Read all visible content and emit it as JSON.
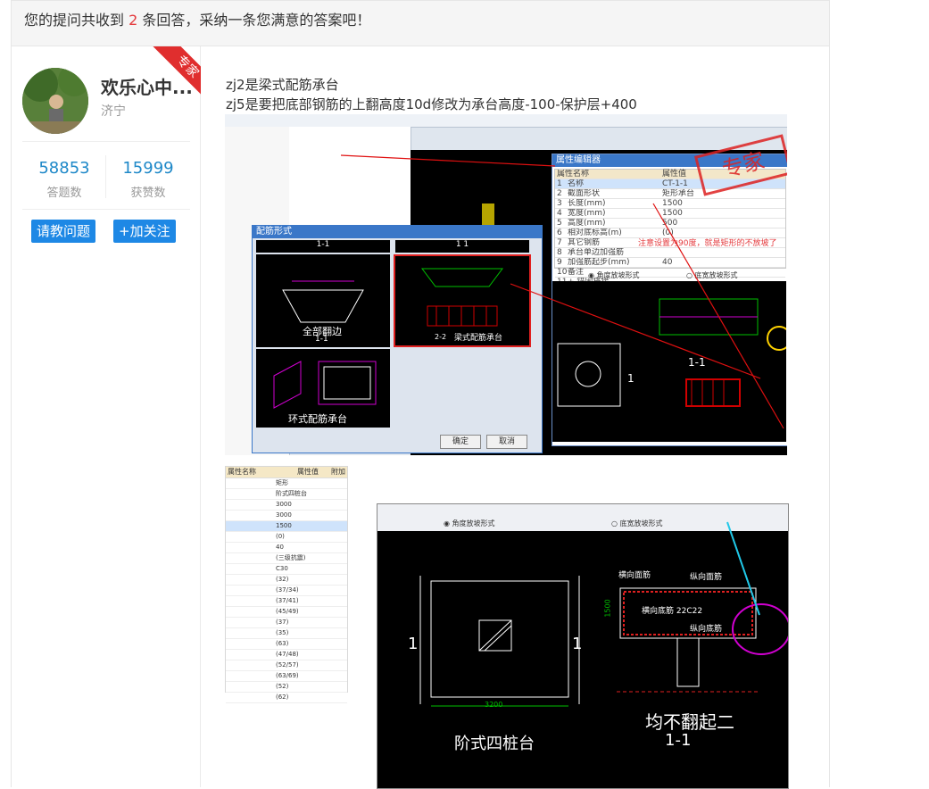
{
  "header": {
    "prefix": "您的提问共收到",
    "count": "2",
    "suffix": "条回答，采纳一条您满意的答案吧！"
  },
  "user": {
    "name": "欢乐心中...",
    "city": "济宁",
    "badge": "专家",
    "answers_value": "58853",
    "answers_label": "答题数",
    "likes_value": "15999",
    "likes_label": "获赞数"
  },
  "buttons": {
    "ask": "请教问题",
    "follow": "+加关注"
  },
  "answer": {
    "line1": "zj2是梁式配筋承台",
    "line2": "zj5是要把底部钢筋的上翻高度10d修改为承台高度-100-保护层+400"
  },
  "screenshot1": {
    "dialog_title": "配筋形式",
    "section_a": "1-1",
    "section_b": "1  1",
    "opt1": "全部翻边",
    "opt1_sec": "1-1",
    "opt2": "梁式配筋承台",
    "opt2_sec": "2-2",
    "opt3": "环式配筋承台",
    "ok": "确定",
    "cancel": "取消",
    "stamp": "专家",
    "note": "注意设置为90度，就是矩形的不放坡了",
    "prop_title": "属性编辑器",
    "prop_header_name": "属性名称",
    "prop_header_value": "属性值",
    "rows": [
      {
        "n": "1",
        "name": "名称",
        "value": "CT-1-1"
      },
      {
        "n": "2",
        "name": "截面形状",
        "value": "矩形承台"
      },
      {
        "n": "3",
        "name": "长度(mm)",
        "value": "1500"
      },
      {
        "n": "4",
        "name": "宽度(mm)",
        "value": "1500"
      },
      {
        "n": "5",
        "name": "高度(mm)",
        "value": "500"
      },
      {
        "n": "6",
        "name": "相对底标高(m)",
        "value": "(0)"
      },
      {
        "n": "7",
        "name": "其它钢筋",
        "value": ""
      },
      {
        "n": "8",
        "name": "承台单边加强筋",
        "value": ""
      },
      {
        "n": "9",
        "name": "加强筋起步(mm)",
        "value": "40"
      },
      {
        "n": "10",
        "name": "备注",
        "value": ""
      },
      {
        "n": "11",
        "name": "+ 锚固搭接",
        "value": ""
      }
    ],
    "radio1": "角度放坡形式",
    "radio2": "底宽放坡形式",
    "label_section": "1-1",
    "label_one": "1"
  },
  "screenshot2": {
    "header_name": "属性名称",
    "header_value": "属性值",
    "header_extra": "附加",
    "values": [
      "矩形",
      "阶式四桩台",
      "3000",
      "3000",
      "1500",
      "(0)",
      "40",
      "(三级抗震)",
      "C30",
      "(32)",
      "(37/34)",
      "(37/41)",
      "(45/49)",
      "(37)",
      "(35)",
      "(63)",
      "(47/48)",
      "(52/57)",
      "(63/69)",
      "(52)",
      "(62)"
    ],
    "radio1": "角度放坡形式",
    "radio2": "底宽放坡形式",
    "plan_caption": "阶式四桩台",
    "section_caption": "均不翻起二",
    "section_sec": "1-1",
    "dim_3200": "3200",
    "dim_1500": "1500",
    "label_top": "横向面筋",
    "label_top2": "纵向面筋",
    "label_bottom": "横向底筋 22C22",
    "label_bottom2": "纵向底筋",
    "one": "1"
  }
}
